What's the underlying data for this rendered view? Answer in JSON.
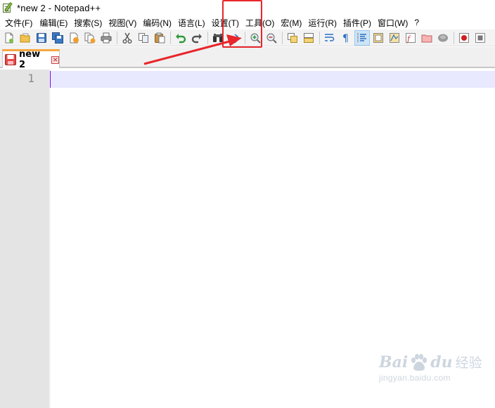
{
  "window": {
    "title": "*new 2 - Notepad++"
  },
  "menubar": {
    "items": [
      {
        "label": "文件(F)"
      },
      {
        "label": "编辑(E)"
      },
      {
        "label": "搜索(S)"
      },
      {
        "label": "视图(V)"
      },
      {
        "label": "编码(N)"
      },
      {
        "label": "语言(L)"
      },
      {
        "label": "设置(T)"
      },
      {
        "label": "工具(O)"
      },
      {
        "label": "宏(M)"
      },
      {
        "label": "运行(R)"
      },
      {
        "label": "插件(P)"
      },
      {
        "label": "窗口(W)"
      },
      {
        "label": "?"
      }
    ]
  },
  "toolbar": {
    "buttons": [
      "new-file-icon",
      "open-file-icon",
      "save-icon",
      "save-all-icon",
      "close-icon",
      "close-all-icon",
      "print-icon",
      "cut-icon",
      "copy-icon",
      "paste-icon",
      "undo-icon",
      "redo-icon",
      "find-icon",
      "replace-icon",
      "zoom-in-icon",
      "zoom-out-icon",
      "sync-vertical-icon",
      "sync-horizontal-icon",
      "word-wrap-icon",
      "show-all-chars-icon",
      "indent-guide-icon",
      "udl-icon",
      "doc-map-icon",
      "function-list-icon",
      "folder-workspace-icon",
      "monitoring-icon",
      "record-macro-icon",
      "stop-macro-icon"
    ]
  },
  "tabs": [
    {
      "label": "new 2",
      "modified": true,
      "close": "×"
    }
  ],
  "editor": {
    "line_numbers": [
      "1"
    ]
  },
  "annotation": {
    "highlight_color": "#e8262b",
    "target_menu": "设置(T)"
  },
  "watermark": {
    "brand_left": "Bai",
    "brand_right": "du",
    "brand_cn": "经验",
    "url": "jingyan.baidu.com"
  },
  "colors": {
    "tab_accent": "#f5a742",
    "current_line": "#e8e8ff",
    "gutter": "#e4e4e4",
    "caret": "#8000ff"
  }
}
